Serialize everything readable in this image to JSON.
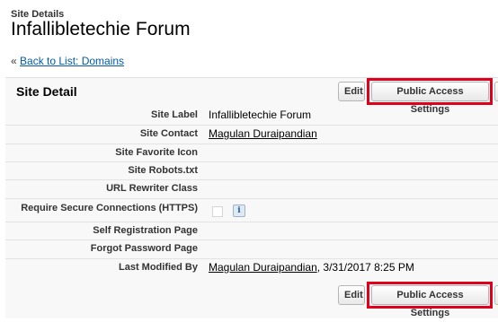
{
  "header": {
    "page_type": "Site Details",
    "title": "Infallibletechie Forum",
    "back_prefix": "« ",
    "back_link": "Back to List: Domains"
  },
  "section": {
    "title": "Site Detail",
    "buttons": {
      "edit": "Edit",
      "public_access": "Public Access Settings"
    }
  },
  "fields": {
    "site_label": {
      "label": "Site Label",
      "value": "Infallibletechie Forum"
    },
    "site_contact": {
      "label": "Site Contact",
      "value": "Magulan Duraipandian"
    },
    "site_favorite_icon": {
      "label": "Site Favorite Icon",
      "value": ""
    },
    "site_robots": {
      "label": "Site Robots.txt",
      "value": ""
    },
    "url_rewriter": {
      "label": "URL Rewriter Class",
      "value": ""
    },
    "require_secure": {
      "label": "Require Secure Connections (HTTPS)",
      "checked": false,
      "info_icon": "i"
    },
    "self_registration": {
      "label": "Self Registration Page",
      "value": ""
    },
    "forgot_password": {
      "label": "Forgot Password Page",
      "value": ""
    },
    "last_modified": {
      "label": "Last Modified By",
      "user": "Magulan Duraipandian",
      "date": ", 3/31/2017 8:25 PM"
    }
  },
  "colors": {
    "highlight": "#e0001b",
    "link": "#015ba7",
    "background": "#f8f8f8"
  }
}
